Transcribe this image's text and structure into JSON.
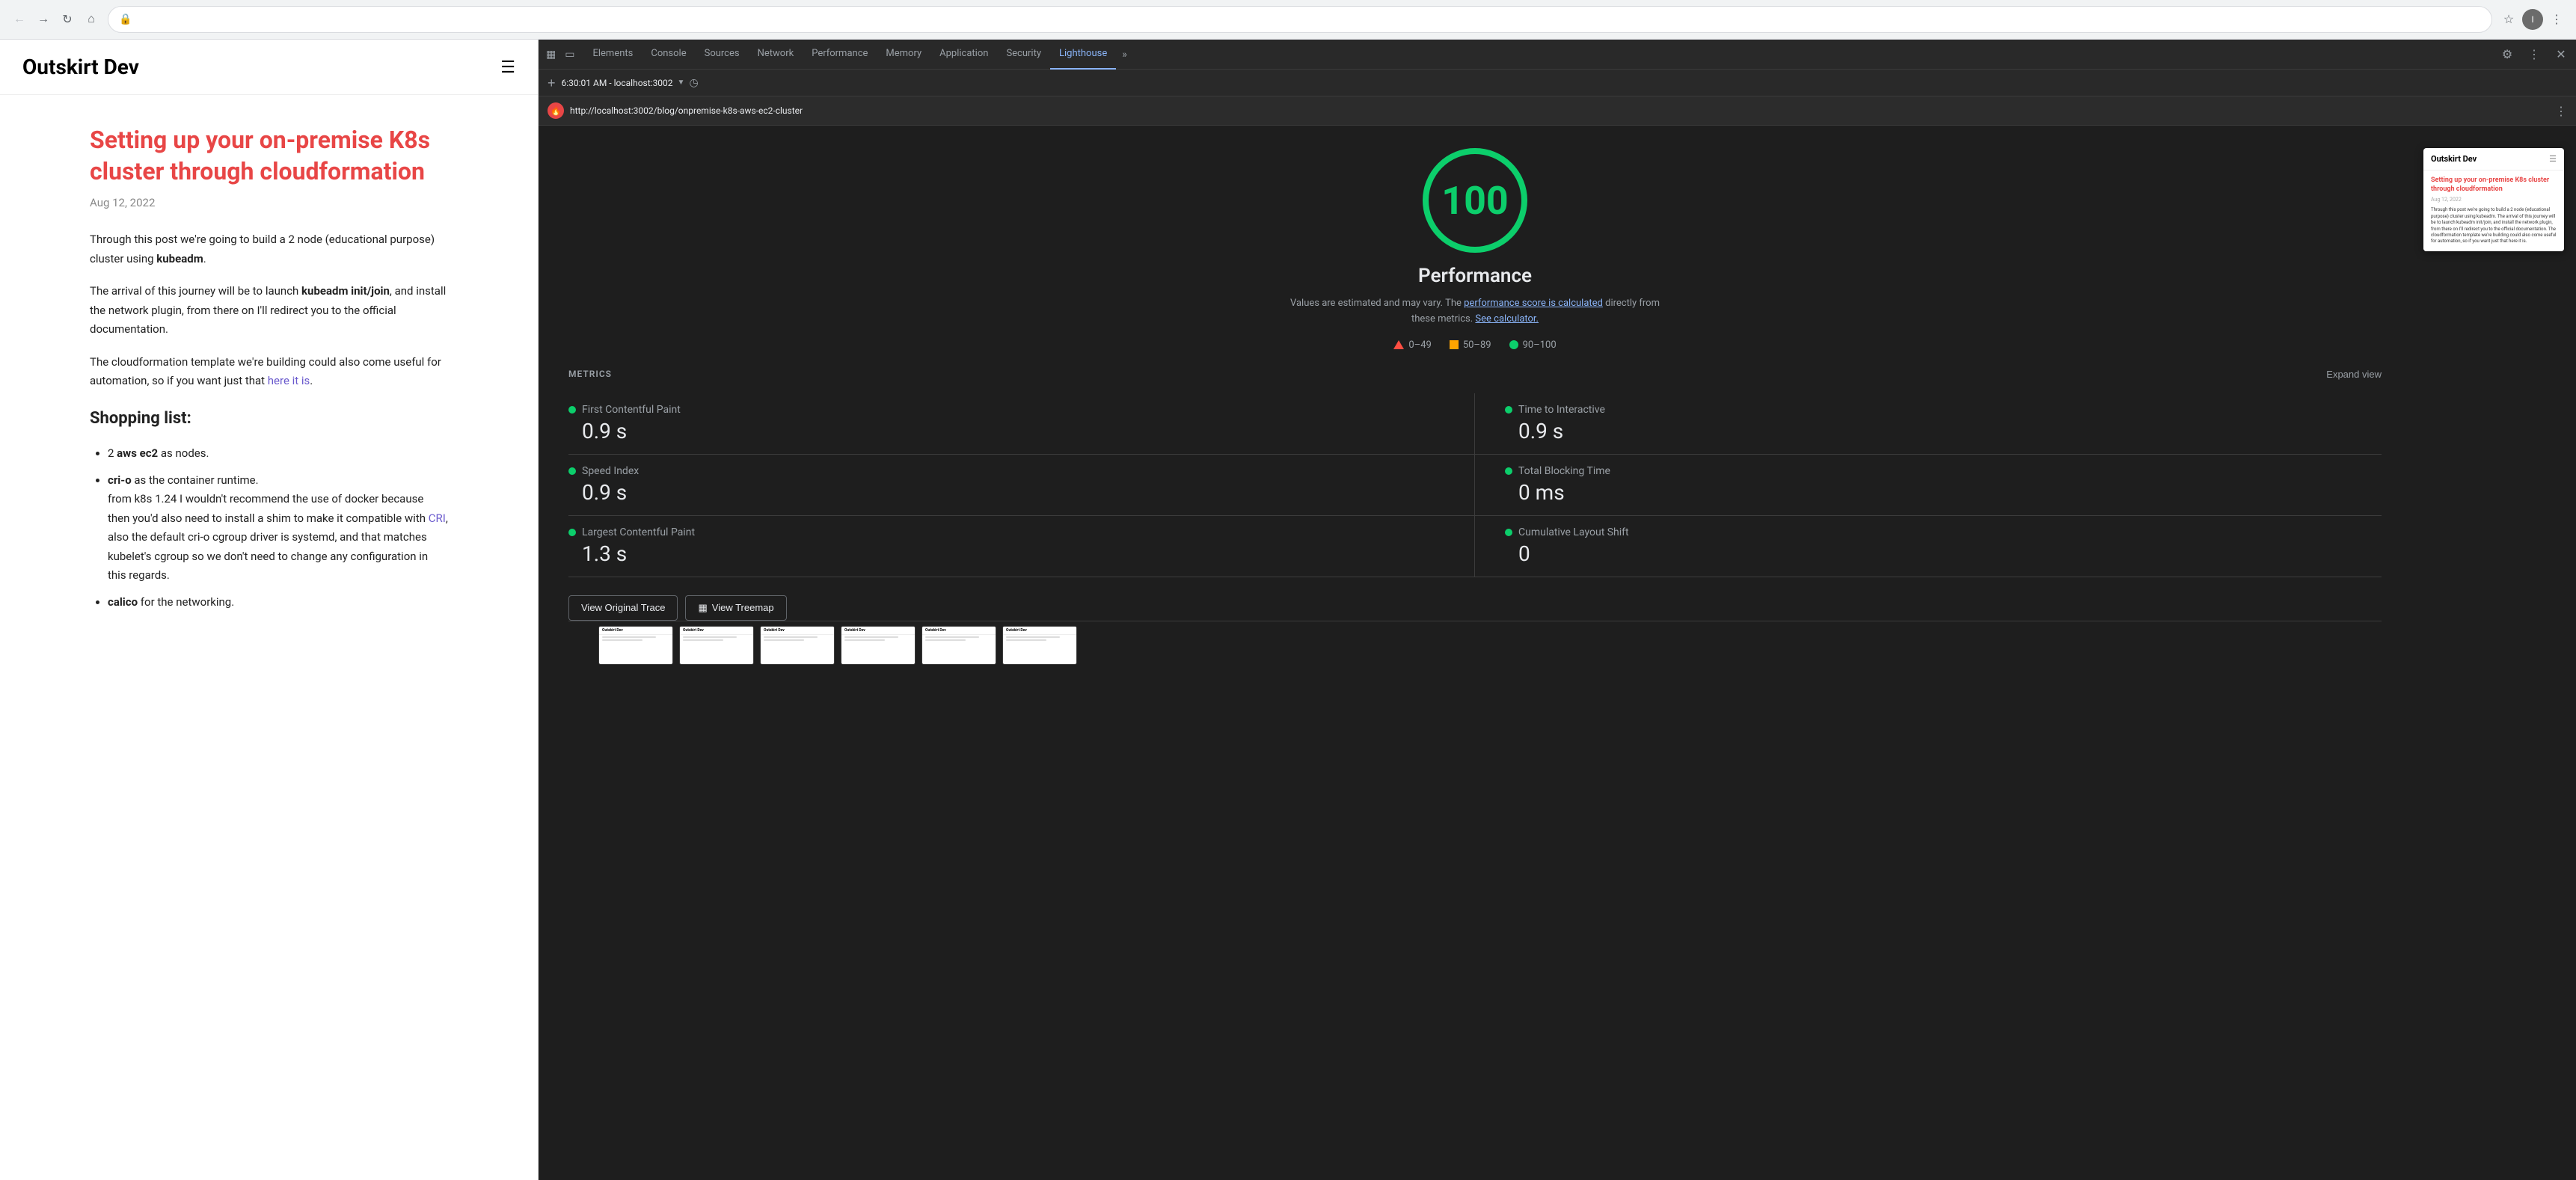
{
  "browser": {
    "url": "localhost:3002/blog/onpremise-k8s-aws-ec2-cluster",
    "full_url": "http://localhost:3002/blog/onpremise-k8s-aws-ec2-cluster",
    "incognito_label": "Incognito"
  },
  "devtools": {
    "tabs": [
      {
        "id": "elements",
        "label": "Elements",
        "active": false
      },
      {
        "id": "console",
        "label": "Console",
        "active": false
      },
      {
        "id": "sources",
        "label": "Sources",
        "active": false
      },
      {
        "id": "network",
        "label": "Network",
        "active": false
      },
      {
        "id": "performance",
        "label": "Performance",
        "active": false
      },
      {
        "id": "memory",
        "label": "Memory",
        "active": false
      },
      {
        "id": "application",
        "label": "Application",
        "active": false
      },
      {
        "id": "security",
        "label": "Security",
        "active": false
      },
      {
        "id": "lighthouse",
        "label": "Lighthouse",
        "active": true
      }
    ],
    "lighthouse_url_bar": "6:30:01 AM - localhost:3002",
    "lighthouse_page_url": "http://localhost:3002/blog/onpremise-k8s-aws-ec2-cluster"
  },
  "blog": {
    "logo": "Outskirt Dev",
    "title": "Setting up your on-premise K8s cluster through cloudformation",
    "date": "Aug 12, 2022",
    "paragraphs": [
      "Through this post we're going to build a 2 node (educational purpose) cluster using kubeadm.",
      "The arrival of this journey will be to launch kubeadm init/join, and install the network plugin, from there on I'll redirect you to the official documentation.",
      "The cloudformation template we're building could also come useful for automation, so if you want just that here it is."
    ],
    "shopping_list_heading": "Shopping list:",
    "items": [
      {
        "text": "2 aws ec2 as nodes."
      },
      {
        "text": "cri-o as the container runtime.",
        "sub": "from k8s 1.24 I wouldn't recommend the use of docker because then you'd also need to install a shim to make it compatible with CRI, also the default cri-o cgroup driver is systemd, and that matches kubelet's cgroup so we don't need to change any configuration in this regards."
      },
      {
        "text": "calico for the networking."
      }
    ]
  },
  "lighthouse": {
    "score": "100",
    "score_label": "Performance",
    "score_description": "Values are estimated and may vary. The performance score is calculated directly from these metrics.",
    "see_calculator": "See calculator.",
    "legend": [
      {
        "type": "triangle",
        "range": "0–49"
      },
      {
        "type": "square",
        "range": "50–89"
      },
      {
        "type": "circle",
        "range": "90–100"
      }
    ],
    "metrics_title": "METRICS",
    "expand_view": "Expand view",
    "metrics": [
      {
        "name": "First Contentful Paint",
        "value": "0.9 s"
      },
      {
        "name": "Time to Interactive",
        "value": "0.9 s"
      },
      {
        "name": "Speed Index",
        "value": "0.9 s"
      },
      {
        "name": "Total Blocking Time",
        "value": "0 ms"
      },
      {
        "name": "Largest Contentful Paint",
        "value": "1.3 s"
      },
      {
        "name": "Cumulative Layout Shift",
        "value": "0"
      }
    ],
    "action_buttons": [
      {
        "id": "view-trace",
        "label": "View Original Trace"
      },
      {
        "id": "view-treemap",
        "label": "View Treemap"
      }
    ],
    "preview": {
      "site_title": "Outskirt Dev",
      "blog_title": "Setting up your on-premise K8s cluster through cloudformation",
      "date": "Aug 12, 2022",
      "body_preview": "Through this post we're going to build a 2 node (educational purpose) cluster using kubeadm. The arrival of this journey will be to launch kubeadm init/join, and install the network plugin, from there on I'll redirect you to the official documentation. The cloudformation template we're building could also come useful for automation, so if you want just that here it is."
    }
  }
}
